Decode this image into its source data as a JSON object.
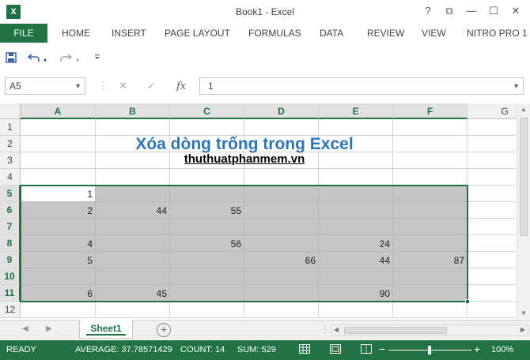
{
  "window": {
    "app_icon": "X",
    "title": "Book1 - Excel",
    "buttons": [
      "?",
      "⧉",
      "—",
      "☐",
      "✕"
    ]
  },
  "ribbon": {
    "file_tab": "FILE",
    "tabs": [
      "HOME",
      "INSERT",
      "PAGE LAYOUT",
      "FORMULAS",
      "DATA",
      "REVIEW",
      "VIEW",
      "NITRO PRO 1"
    ]
  },
  "qat": {
    "icons": [
      "save-icon",
      "undo-icon",
      "redo-icon",
      "customize-icon"
    ]
  },
  "formula_bar": {
    "name_box": "A5",
    "fx_label": "fx",
    "value": "1"
  },
  "columns": [
    "A",
    "B",
    "C",
    "D",
    "E",
    "F",
    "G"
  ],
  "rows": [
    "1",
    "2",
    "3",
    "4",
    "5",
    "6",
    "7",
    "8",
    "9",
    "10",
    "11",
    "12"
  ],
  "sheet": {
    "title": "Xóa dòng trống trong Excel",
    "subtitle": "thuthuatphanmem.vn",
    "cells": [
      {
        "r": 5,
        "c": "A",
        "v": "1"
      },
      {
        "r": 6,
        "c": "A",
        "v": "2"
      },
      {
        "r": 6,
        "c": "B",
        "v": "44"
      },
      {
        "r": 6,
        "c": "C",
        "v": "55"
      },
      {
        "r": 8,
        "c": "A",
        "v": "4"
      },
      {
        "r": 8,
        "c": "C",
        "v": "56"
      },
      {
        "r": 8,
        "c": "E",
        "v": "24"
      },
      {
        "r": 9,
        "c": "A",
        "v": "5"
      },
      {
        "r": 9,
        "c": "D",
        "v": "66"
      },
      {
        "r": 9,
        "c": "E",
        "v": "44"
      },
      {
        "r": 9,
        "c": "F",
        "v": "87"
      },
      {
        "r": 11,
        "c": "A",
        "v": "6"
      },
      {
        "r": 11,
        "c": "B",
        "v": "45"
      },
      {
        "r": 11,
        "c": "E",
        "v": "90"
      }
    ]
  },
  "sheet_tabs": {
    "active": "Sheet1",
    "add_label": "+"
  },
  "status": {
    "mode": "READY",
    "average": "AVERAGE: 37.78571429",
    "count": "COUNT: 14",
    "sum": "SUM: 529",
    "zoom": "100%",
    "zoom_minus": "−",
    "zoom_plus": "+"
  },
  "colors": {
    "accent": "#217346",
    "title_blue": "#2e75b6",
    "selection_fill": "#c6c6c6"
  }
}
